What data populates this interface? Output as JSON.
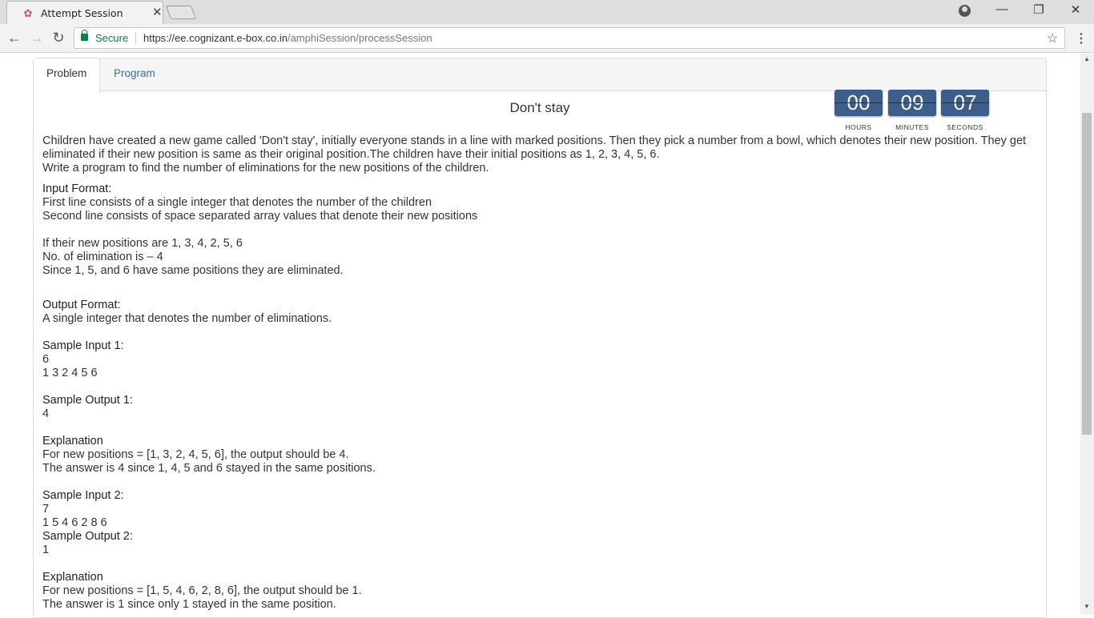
{
  "browser": {
    "tab_title": "Attempt Session",
    "secure_label": "Secure",
    "url_host": "https://ee.cognizant.e-box.co.in",
    "url_path": "/amphiSession/processSession"
  },
  "tabs": {
    "problem": "Problem",
    "program": "Program"
  },
  "problem": {
    "title": "Don't stay",
    "description": [
      "Children have created a new game called 'Don't stay', initially everyone stands in a line with marked positions. Then they pick a number from a bowl, which denotes their new position. They get eliminated if their new position is same as their original position.The children have their initial positions as 1, 2, 3, 4, 5, 6.",
      "Write a program to find the number of eliminations for the new positions of the children."
    ],
    "input_format_heading": "Input Format:",
    "input_format_lines": [
      "First line consists of a single integer that denotes the number of the children",
      "Second line consists of space separated array values that denote their new positions"
    ],
    "example_lines": [
      "If their new positions are 1, 3, 4, 2, 5, 6",
      "No. of elimination is – 4",
      "Since 1, 5, and 6 have same positions they are eliminated."
    ],
    "output_format_heading": "Output Format:",
    "output_format_line": "A single integer that denotes the number of eliminations.",
    "sample_input_1_heading": "Sample Input 1:",
    "sample_input_1": [
      "6",
      "1 3 2 4 5 6"
    ],
    "sample_output_1_heading": "Sample Output 1:",
    "sample_output_1": "4",
    "explanation_1_heading": "Explanation",
    "explanation_1": [
      "For new positions = [1, 3, 2, 4, 5, 6], the output should be 4.",
      "The answer is 4 since 1, 4, 5 and 6 stayed in the same positions."
    ],
    "sample_input_2_heading": "Sample Input 2:",
    "sample_input_2": [
      "7",
      "1 5 4 6 2 8 6"
    ],
    "sample_output_2_heading": "Sample Output 2:",
    "sample_output_2": "1",
    "explanation_2_heading": "Explanation",
    "explanation_2": [
      "For new positions = [1, 5, 4, 6, 2, 8, 6], the output should be 1.",
      "The answer is 1 since only 1 stayed in the same position."
    ]
  },
  "timer": {
    "hours": "00",
    "minutes": "09",
    "seconds": "07",
    "hours_label": "HOURS",
    "minutes_label": "MINUTES",
    "seconds_label": "SECONDS"
  },
  "colors": {
    "timer_bg": "#3d5d8a",
    "secure_green": "#0b8043",
    "link_blue": "#3a6fa8"
  }
}
